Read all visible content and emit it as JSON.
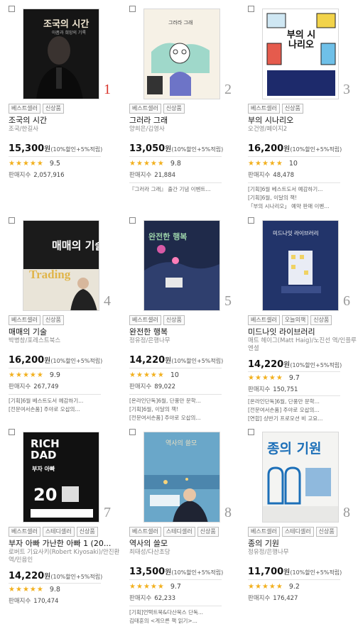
{
  "books": [
    {
      "rank": "1",
      "badges": [
        "베스트셀러",
        "신상품"
      ],
      "title": "조국의 시간",
      "author": "조국/한길사",
      "price": "15,300",
      "currency": "원",
      "discount": "(10%할인+5%적립)",
      "rating": "9.5",
      "sales_label": "판매지수",
      "sales": "2,057,916",
      "notes": [],
      "cover": {
        "title": "조국의 시간",
        "subtitle": "아픔과 희망의 기록",
        "bg": "#1a1a1a",
        "accent": "#c8a870"
      }
    },
    {
      "rank": "2",
      "badges": [
        "베스트셀러",
        "신상품"
      ],
      "title": "그러라 그래",
      "author": "양희은/김영사",
      "price": "13,050",
      "currency": "원",
      "discount": "(10%할인+5%적립)",
      "rating": "9.8",
      "sales_label": "판매지수",
      "sales": "21,884",
      "notes": [
        "『그러라 그래』 출간 기념 이벤트..."
      ],
      "cover": {
        "title": "그러라 그래",
        "subtitle": "",
        "bg": "#f6f1e6",
        "accent": "#5dbfa9"
      }
    },
    {
      "rank": "3",
      "badges": [
        "베스트셀러",
        "신상품"
      ],
      "title": "부의 시나리오",
      "author": "오건영/페이지2",
      "price": "16,200",
      "currency": "원",
      "discount": "(10%할인+5%적립)",
      "rating": "10",
      "sales_label": "판매지수",
      "sales": "48,478",
      "notes": [
        "[기획]6월 베스트도서 예감하기...",
        "[기획]6월, 이달의 책!",
        "「부의 시나리오」 예약 판매 이벤..."
      ],
      "cover": {
        "title": "부의 시나리오",
        "subtitle": "",
        "bg": "#ffffff",
        "accent": "#1d2a6b"
      }
    },
    {
      "rank": "4",
      "badges": [
        "베스트셀러",
        "신상품"
      ],
      "title": "매매의 기술",
      "author": "박병창/포레스트북스",
      "price": "16,200",
      "currency": "원",
      "discount": "(10%할인+5%적립)",
      "rating": "9.9",
      "sales_label": "판매지수",
      "sales": "267,749",
      "notes": [
        "[기획]6월 베스트도서 예감하기...",
        "[전문여서손품] 주야로 오삽의..."
      ],
      "cover": {
        "title": "매매의 기술",
        "subtitle": "Trading",
        "bg": "#1b1b1b",
        "accent": "#e0b54a"
      }
    },
    {
      "rank": "5",
      "badges": [
        "베스트셀러",
        "신상품"
      ],
      "title": "완전한 행복",
      "author": "정유정/은행나무",
      "price": "14,220",
      "currency": "원",
      "discount": "(10%할인+5%적립)",
      "rating": "10",
      "sales_label": "판매지수",
      "sales": "89,022",
      "notes": [
        "[온라인단독]6월, 단풍만 문학...",
        "[기획]6월, 이달의 책!",
        "[전문여서손품] 주야로 오삽의..."
      ],
      "cover": {
        "title": "완전한 행복",
        "subtitle": "",
        "bg": "#1f2a4a",
        "accent": "#d85aa6"
      }
    },
    {
      "rank": "6",
      "badges": [
        "베스트셀러",
        "오늘의책",
        "신상품"
      ],
      "title": "미드나잇 라이브러리",
      "author": "매트 헤이그(Matt Haig)/노진선 역/인플루엔셜",
      "price": "14,220",
      "currency": "원",
      "discount": "(10%할인+5%적립)",
      "rating": "9.7",
      "sales_label": "판매지수",
      "sales": "150,751",
      "notes": [
        "[온라인단독]6월, 단풍만 문학...",
        "[전문여서손품] 주야로 오삽의...",
        "[연합] 상반기 프로모션 비 고요..."
      ],
      "cover": {
        "title": "미드나잇 라이브러리",
        "subtitle": "",
        "bg": "#22346a",
        "accent": "#f0d264"
      }
    },
    {
      "rank": "7",
      "badges": [
        "베스트셀러",
        "스테디셀러",
        "신상품"
      ],
      "title": "부자 아빠 가난한 아빠 1 (20...",
      "author": "로버트 기요사키(Robert Kiyosaki)/안진환 역/민음인",
      "price": "14,220",
      "currency": "원",
      "discount": "(10%할인+5%적립)",
      "rating": "9.8",
      "sales_label": "판매지수",
      "sales": "170,474",
      "notes": [],
      "cover": {
        "title": "RICH DAD",
        "subtitle": "부자 아빠",
        "bg": "#111111",
        "accent": "#ffffff"
      }
    },
    {
      "rank": "8",
      "badges": [
        "베스트셀러",
        "스테디셀러",
        "신상품"
      ],
      "title": "역사의 쓸모",
      "author": "최태성/다산초당",
      "price": "13,500",
      "currency": "원",
      "discount": "(10%할인+5%적립)",
      "rating": "9.7",
      "sales_label": "판매지수",
      "sales": "62,233",
      "notes": [
        "[기획]언택트북&다산북스 단독...",
        "김태훈의 <게으른 책 읽기>..."
      ],
      "cover": {
        "title": "역사의 쓸모",
        "subtitle": "",
        "bg": "#6aa7c9",
        "accent": "#e9dfc1"
      }
    },
    {
      "rank": "8",
      "badges": [
        "베스트셀러",
        "스테디셀러",
        "신상품"
      ],
      "title": "종의 기원",
      "author": "정유정/은행나무",
      "price": "11,700",
      "currency": "원",
      "discount": "(10%할인+5%적립)",
      "rating": "9.2",
      "sales_label": "판매지수",
      "sales": "176,427",
      "notes": [],
      "cover": {
        "title": "종의 기원",
        "subtitle": "",
        "bg": "#f4f4f2",
        "accent": "#1c6fb8"
      }
    }
  ]
}
